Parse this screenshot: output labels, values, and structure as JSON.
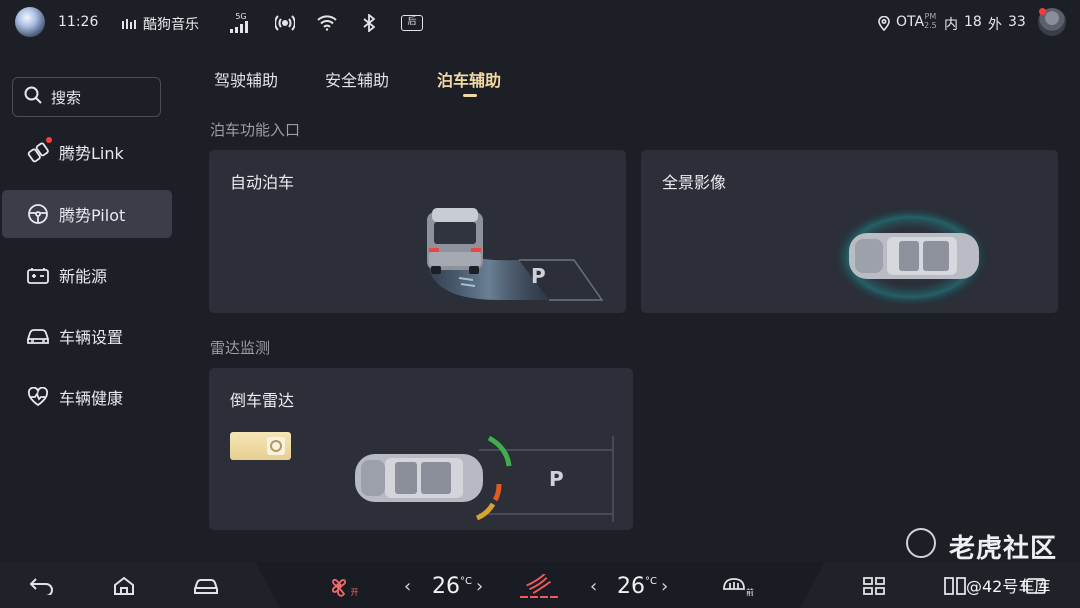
{
  "status_bar": {
    "time": "11:26",
    "music_app": "酷狗音乐",
    "signal_label": "5G",
    "gear_icon_label": "后",
    "ota": "OTA",
    "pm_top": "PM",
    "pm_bottom": "2.5",
    "inside_label": "内",
    "inside_value": "18",
    "outside_label": "外",
    "outside_value": "33"
  },
  "sidebar": {
    "search_label": "搜索",
    "items": [
      {
        "label": "腾势Link",
        "icon": "link-icon"
      },
      {
        "label": "腾势Pilot",
        "icon": "steering-wheel-icon"
      },
      {
        "label": "新能源",
        "icon": "battery-icon"
      },
      {
        "label": "车辆设置",
        "icon": "car-icon"
      },
      {
        "label": "车辆健康",
        "icon": "heart-pulse-icon"
      }
    ]
  },
  "tabs": [
    {
      "label": "驾驶辅助"
    },
    {
      "label": "安全辅助"
    },
    {
      "label": "泊车辅助",
      "active": true
    }
  ],
  "sections": {
    "parking_entry": "泊车功能入口",
    "radar_monitor": "雷达监测"
  },
  "cards": {
    "auto_parking": {
      "title": "自动泊车",
      "p_mark": "P"
    },
    "panoramic": {
      "title": "全景影像"
    },
    "reverse_radar": {
      "title": "倒车雷达",
      "p_mark": "P",
      "enabled": true
    }
  },
  "watermark": {
    "title": "老虎社区",
    "subtitle": "@42号车库"
  },
  "dock": {
    "fan_label": "开",
    "left_temp": "26",
    "right_temp": "26",
    "temp_unit": "°C",
    "defrost_label": "前"
  },
  "colors": {
    "accent": "#f1d9a3",
    "background": "#1d1f27",
    "card": "#2c2e38"
  }
}
